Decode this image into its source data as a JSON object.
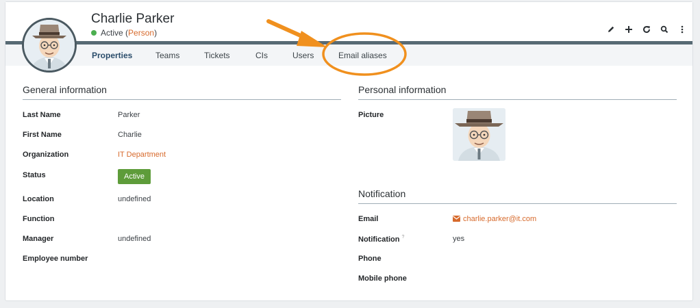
{
  "person": {
    "name": "Charlie Parker",
    "status": "Active",
    "class_open": " (",
    "class_name": "Person",
    "class_close": ")"
  },
  "toolbar": {
    "edit_icon": "pencil-icon",
    "new_icon": "plus-icon",
    "refresh_icon": "refresh-icon",
    "search_icon": "search-icon",
    "more_icon": "kebab-menu-icon"
  },
  "tabs": [
    {
      "label": "Properties",
      "active": true
    },
    {
      "label": "Teams"
    },
    {
      "label": "Tickets"
    },
    {
      "label": "CIs"
    },
    {
      "label": "Users"
    },
    {
      "label": "Email aliases"
    }
  ],
  "general": {
    "title": "General information",
    "fields": [
      {
        "label": "Last Name",
        "value": "Parker"
      },
      {
        "label": "First Name",
        "value": "Charlie"
      },
      {
        "label": "Organization",
        "value": "IT Department"
      },
      {
        "label": "Status",
        "value": "Active"
      },
      {
        "label": "Location",
        "value": "undefined"
      },
      {
        "label": "Function",
        "value": ""
      },
      {
        "label": "Manager",
        "value": "undefined"
      },
      {
        "label": "Employee number",
        "value": ""
      }
    ]
  },
  "personal": {
    "title": "Personal information",
    "picture_label": "Picture"
  },
  "notification": {
    "title": "Notification",
    "fields": [
      {
        "label": "Email",
        "value": "charlie.parker@it.com"
      },
      {
        "label": "Notification",
        "value": "yes",
        "help": "?"
      },
      {
        "label": "Phone",
        "value": ""
      },
      {
        "label": "Mobile phone",
        "value": ""
      }
    ]
  },
  "colors": {
    "accent": "#d76a2c",
    "status_active": "#5e9c3a",
    "tab_bar": "#576a74",
    "annotation": "#f0901e"
  }
}
